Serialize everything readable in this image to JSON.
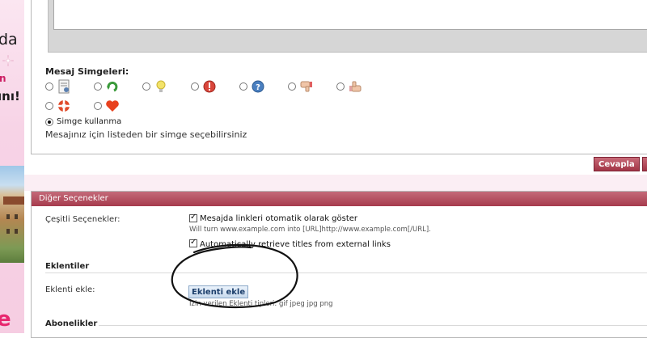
{
  "ad": {
    "text1": "da",
    "text2": "n",
    "text3": "ını!",
    "text4": "e"
  },
  "message_icons": {
    "title": "Mesaj Simgeleri:",
    "row1": [
      {
        "icon": "document-icon"
      },
      {
        "icon": "green-arrow-icon"
      },
      {
        "icon": "lightbulb-icon"
      },
      {
        "icon": "exclamation-icon"
      },
      {
        "icon": "question-icon"
      },
      {
        "icon": "thumbs-down-icon"
      },
      {
        "icon": "thumbs-up-icon"
      }
    ],
    "row2": [
      {
        "icon": "lifebuoy-icon"
      },
      {
        "icon": "heart-icon"
      }
    ],
    "no_icon_label": "Simge kullanma",
    "hint": "Mesajınız için listeden bir simge seçebilirsiniz"
  },
  "buttons": {
    "reply": "Cevapla",
    "preview": "Ö"
  },
  "other_options": {
    "header": "Diğer Seçenekler",
    "misc_label": "Çeşitli Seçenekler:",
    "auto_links": "Mesajda linkleri otomatik olarak göster",
    "auto_links_hint": "Will turn www.example.com into [URL]http://www.example.com[/URL].",
    "auto_titles": "Automatically retrieve titles from external links",
    "attachments_title": "Eklentiler",
    "add_attachment_label": "Eklenti ekle:",
    "add_attachment_button": "Eklenti ekle",
    "allowed_types": "İzin verilen Eklenti tipleri: gif jpeg jpg png",
    "subscriptions_title": "Abonelikler"
  }
}
